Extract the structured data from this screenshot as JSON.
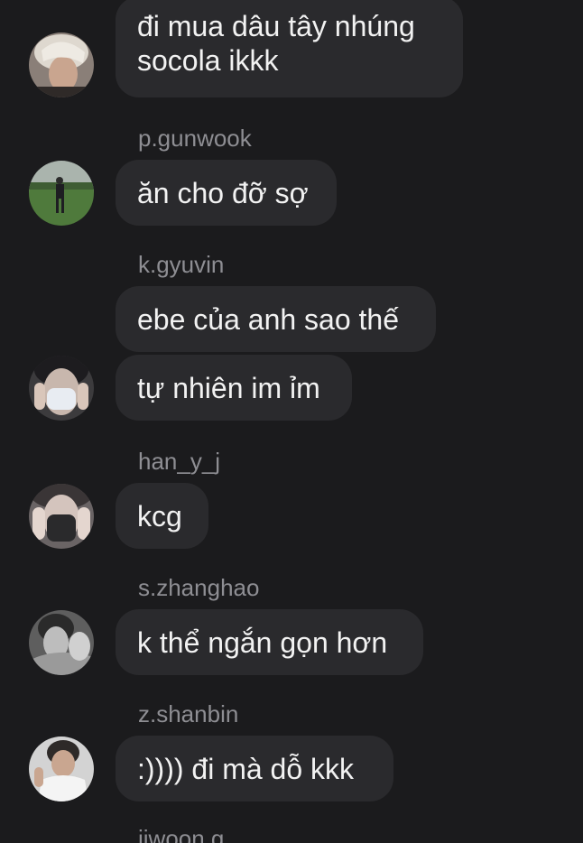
{
  "messages": [
    {
      "text": "đi mua dâu tây nhúng socola ikkk"
    },
    {
      "username": "p.gunwook",
      "text": "ăn cho đỡ sợ"
    },
    {
      "username": "k.gyuvin",
      "text": "ebe của anh sao thế"
    },
    {
      "text": "tự nhiên im ỉm"
    },
    {
      "username": "han_y_j",
      "text": "kcg"
    },
    {
      "username": "s.zhanghao",
      "text": "k thể ngắn gọn hơn"
    },
    {
      "username": "z.shanbin",
      "text": ":)))) đi mà dỗ kkk"
    },
    {
      "username": "jiwoon.g"
    }
  ],
  "avatars": [
    {
      "icon": "avatar-photo-blond-hair"
    },
    {
      "icon": "avatar-photo-soccer-field"
    },
    {
      "icon": "avatar-photo-face-mask-white"
    },
    {
      "icon": "avatar-photo-face-mask-black"
    },
    {
      "icon": "avatar-photo-monochrome"
    },
    {
      "icon": "avatar-photo-white-shirt"
    }
  ]
}
